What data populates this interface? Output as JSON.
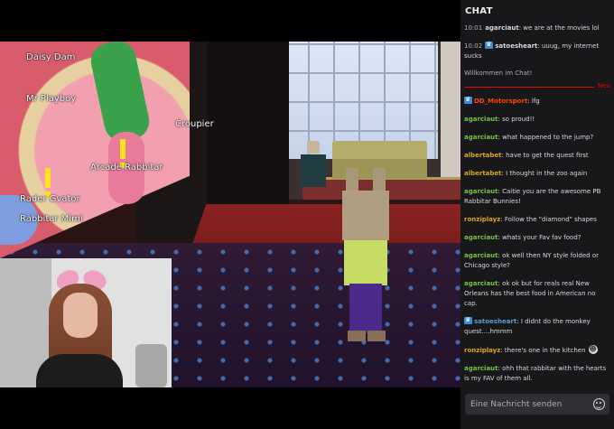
{
  "game": {
    "nametags": [
      "Daisy Dam",
      "Mr Playboy",
      "Croupier",
      "Arcade Rabbitar",
      "Rader Gvator",
      "Rabbitar Mimi"
    ]
  },
  "chat": {
    "title": "CHAT",
    "new_label": "Neu",
    "welcome": "Willkommen im Chat!",
    "colors": {
      "pink": "#ff69b4",
      "green": "#7ac142",
      "red": "#ff4500",
      "gold": "#daa520",
      "blue": "#5b9bd5"
    },
    "pre_messages": [
      {
        "time": "10:01",
        "user": "agarciaut",
        "badge": false,
        "text": "we are at the movies lol",
        "color": "#d8d8dc"
      },
      {
        "time": "10:02",
        "user": "satoesheart",
        "badge": true,
        "text": "uuug, my internet sucks",
        "color": "#d8d8dc"
      }
    ],
    "messages": [
      {
        "user": "DD_Motorsport",
        "badge": true,
        "text": "lfg",
        "color": "#ff4500"
      },
      {
        "user": "agarciaut",
        "badge": false,
        "text": "so proud!!",
        "color": "#7ac142"
      },
      {
        "user": "agarciaut",
        "badge": false,
        "text": "what happened to the jump?",
        "color": "#7ac142"
      },
      {
        "user": "albertabet",
        "badge": false,
        "text": "have to get the quest first",
        "color": "#daa520"
      },
      {
        "user": "albertabet",
        "badge": false,
        "text": "I thought in the zoo again",
        "color": "#daa520"
      },
      {
        "user": "agarciaut",
        "badge": false,
        "text": "Caitie you are the awesome PB Rabbitar Bunnies!",
        "color": "#7ac142"
      },
      {
        "user": "ronziplayz",
        "badge": false,
        "text": "Follow the \"diamond\" shapes",
        "color": "#daa520"
      },
      {
        "user": "agarciaut",
        "badge": false,
        "text": "whats your Fav fav food?",
        "color": "#7ac142"
      },
      {
        "user": "agarciaut",
        "badge": false,
        "text": "ok well then NY style folded or Chicago style?",
        "color": "#7ac142"
      },
      {
        "user": "agarciaut",
        "badge": false,
        "text": "ok ok but for reals real New Orleans has the best food in American no cap.",
        "color": "#7ac142"
      },
      {
        "user": "satoesheart",
        "badge": true,
        "text": "I didnt do the monkey quest....hmmm",
        "color": "#5b9bd5"
      },
      {
        "user": "ronziplayz",
        "badge": false,
        "text": "there's one in the kitchen",
        "color": "#daa520",
        "emote": true
      },
      {
        "user": "agarciaut",
        "badge": false,
        "text": "ohh that rabbitar with the hearts is my FAV of them all.",
        "color": "#7ac142"
      }
    ],
    "input_placeholder": "Eine Nachricht senden"
  }
}
